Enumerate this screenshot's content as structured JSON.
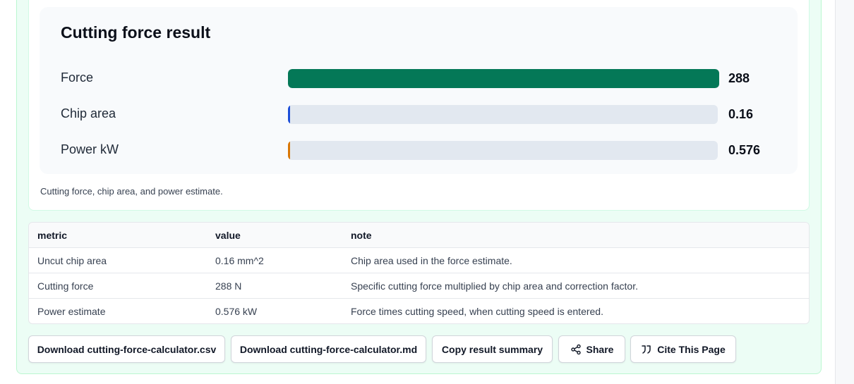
{
  "result": {
    "title": "Cutting force result",
    "caption": "Cutting force, chip area, and power estimate."
  },
  "chart_data": {
    "type": "bar",
    "orientation": "horizontal",
    "title": "Cutting force result",
    "categories": [
      "Force",
      "Chip area",
      "Power kW"
    ],
    "values": [
      288,
      0.16,
      0.576
    ],
    "value_labels": [
      "288",
      "0.16",
      "0.576"
    ],
    "colors": [
      "#047857",
      "#1d4ed8",
      "#d97706"
    ],
    "xlim": [
      0,
      288
    ],
    "grid": false
  },
  "table": {
    "headers": [
      "metric",
      "value",
      "note"
    ],
    "rows": [
      [
        "Uncut chip area",
        "0.16 mm^2",
        "Chip area used in the force estimate."
      ],
      [
        "Cutting force",
        "288 N",
        "Specific cutting force multiplied by chip area and correction factor."
      ],
      [
        "Power estimate",
        "0.576 kW",
        "Force times cutting speed, when cutting speed is entered."
      ]
    ]
  },
  "actions": {
    "download_csv": "Download cutting-force-calculator.csv",
    "download_md": "Download cutting-force-calculator.md",
    "copy_summary": "Copy result summary",
    "share": "Share",
    "cite": "Cite This Page",
    "share_icon": "share-icon",
    "cite_icon": "quote-icon"
  }
}
